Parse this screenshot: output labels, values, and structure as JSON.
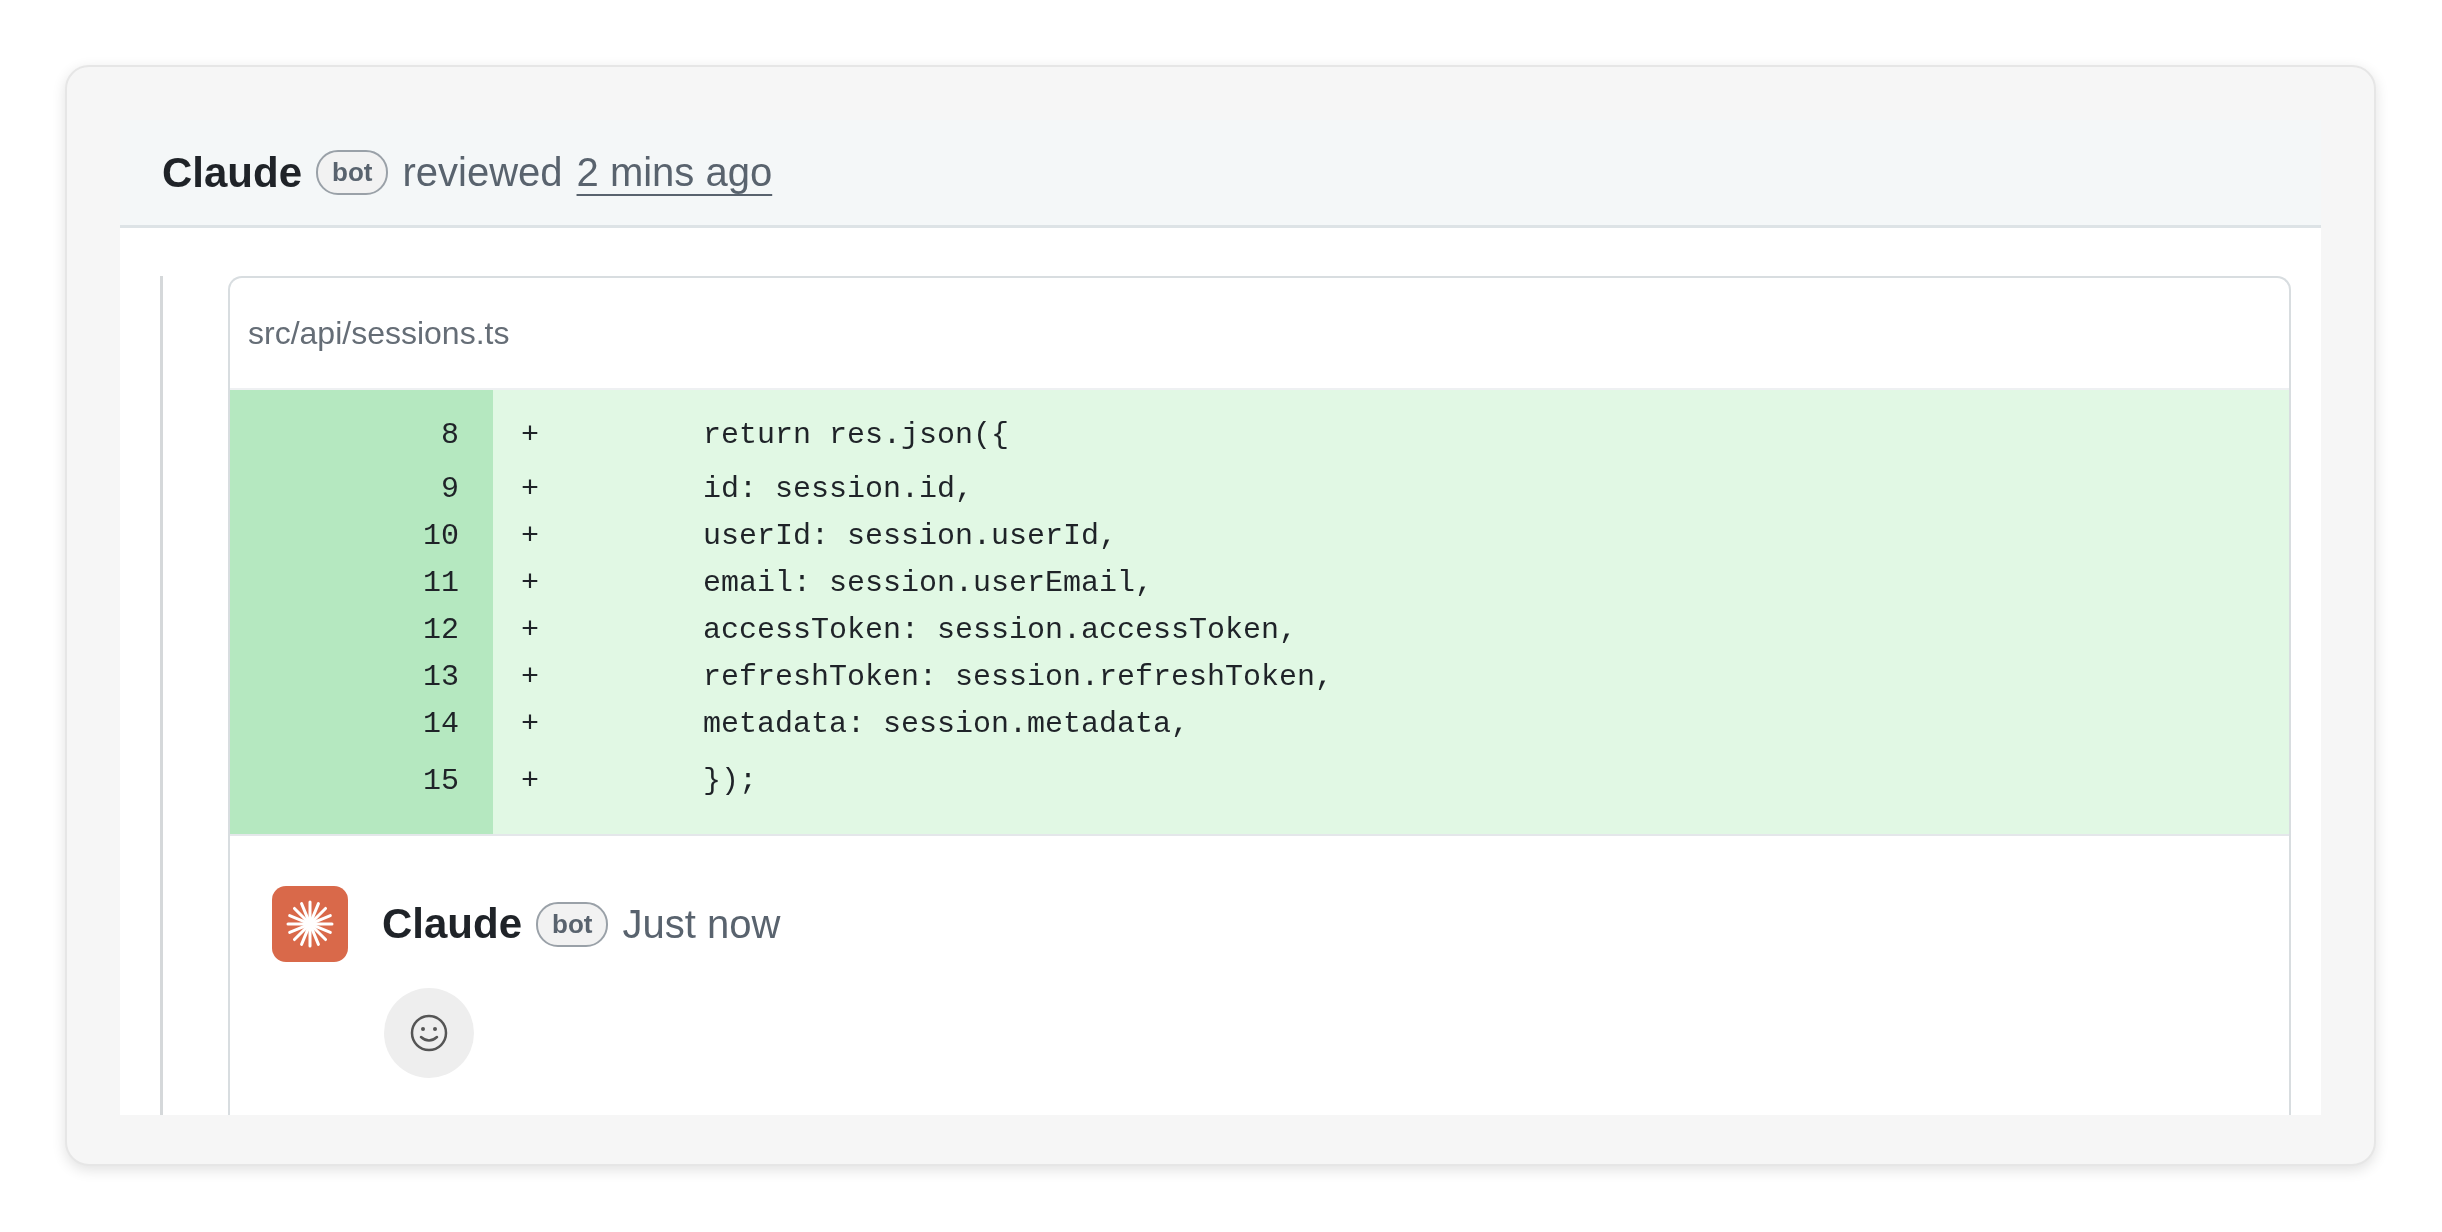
{
  "review": {
    "author": "Claude",
    "badge": "bot",
    "action": "reviewed",
    "time": "2 mins ago"
  },
  "file": {
    "path": "src/api/sessions.ts",
    "lines": [
      {
        "kind": "added",
        "number": "8",
        "marker": "+",
        "code": "return res.json({"
      },
      {
        "kind": "added",
        "number": "9",
        "marker": "+",
        "code": "id: session.id,"
      },
      {
        "kind": "added",
        "number": "10",
        "marker": "+",
        "code": "userId: session.userId,"
      },
      {
        "kind": "added",
        "number": "11",
        "marker": "+",
        "code": "email: session.userEmail,"
      },
      {
        "kind": "added",
        "number": "12",
        "marker": "+",
        "code": "accessToken: session.accessToken,"
      },
      {
        "kind": "added",
        "number": "13",
        "marker": "+",
        "code": "refreshToken: session.refreshToken,"
      },
      {
        "kind": "added",
        "number": "14",
        "marker": "+",
        "code": "metadata: session.metadata,"
      },
      {
        "kind": "added",
        "number": "15",
        "marker": "+",
        "code": "});"
      }
    ]
  },
  "comment": {
    "author": "Claude",
    "badge": "bot",
    "time": "Just now"
  }
}
